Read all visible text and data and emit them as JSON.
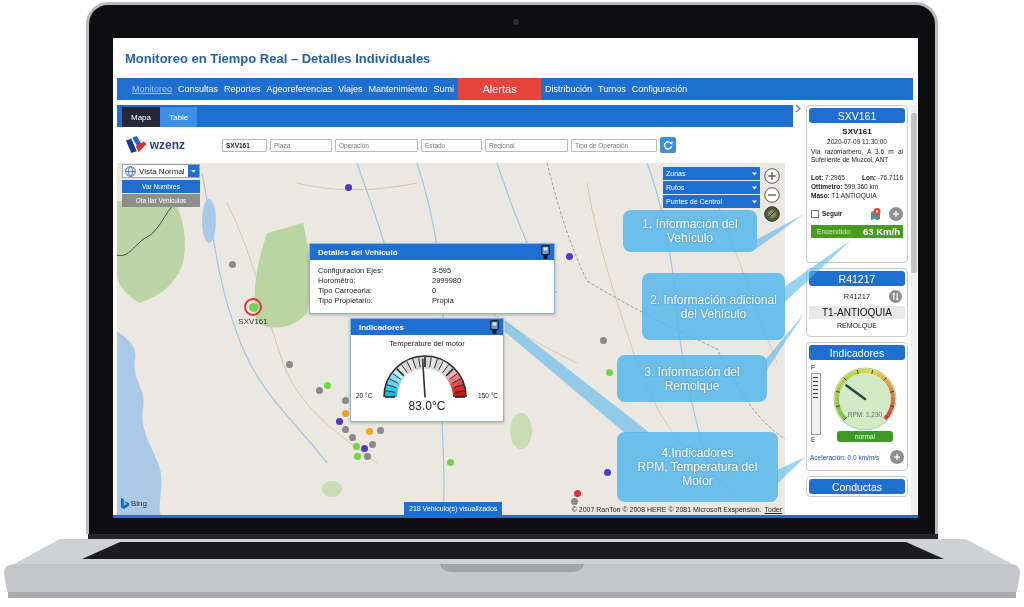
{
  "window": {
    "title": "Monitoreo en Tiempo Real – Detalles Individuales"
  },
  "nav": [
    {
      "label": "Monitoreo",
      "selected": true,
      "kind": "link"
    },
    {
      "label": "Consultas",
      "selected": false,
      "kind": "link"
    },
    {
      "label": "Reportes",
      "selected": false,
      "kind": "link"
    },
    {
      "label": "Ageoreferencias",
      "selected": false,
      "kind": "link"
    },
    {
      "label": "Viajes",
      "selected": false,
      "kind": "link"
    },
    {
      "label": "Mantenimiento",
      "selected": false,
      "kind": "link"
    },
    {
      "label": "Sumi",
      "selected": false,
      "kind": "link"
    },
    {
      "label": "Alertas",
      "selected": false,
      "kind": "alert"
    },
    {
      "label": "Distribución",
      "selected": false,
      "kind": "link"
    },
    {
      "label": "Turnos",
      "selected": false,
      "kind": "link"
    },
    {
      "label": "Configuración",
      "selected": false,
      "kind": "link"
    }
  ],
  "tabs": [
    {
      "label": "Mapa",
      "selected": true
    },
    {
      "label": "Table",
      "selected": false
    }
  ],
  "brand": {
    "name": "wzenz"
  },
  "filters": [
    {
      "value": "SXV161"
    },
    {
      "placeholder": "Plaza"
    },
    {
      "placeholder": "Operación"
    },
    {
      "placeholder": "Estado"
    },
    {
      "placeholder": "Regional"
    },
    {
      "placeholder": "Tipo de Operación"
    }
  ],
  "map": {
    "view_select": {
      "value": "Vista Normal"
    },
    "view_menu": [
      {
        "label": "Var Numbres",
        "selected": true
      },
      {
        "label": "Ota llar Vehiculos",
        "selected": false
      }
    ],
    "layers": [
      {
        "label": "Zunas"
      },
      {
        "label": "Rutos"
      },
      {
        "label": "Puntes de Centrol"
      }
    ],
    "markers": [
      {
        "color": "#4b3cc4",
        "selected": false
      },
      {
        "color": "#8a8a8a",
        "selected": false
      },
      {
        "color": "#72d44c",
        "selected": true,
        "label": "SXV161"
      },
      {
        "color": "#8a8a8a",
        "selected": false
      },
      {
        "color": "#8a8a8a",
        "selected": false
      },
      {
        "color": "#72d44c",
        "selected": false
      },
      {
        "color": "#8a8a8a",
        "selected": false
      },
      {
        "color": "#f0a526",
        "selected": false
      },
      {
        "color": "#4b3cc4",
        "selected": false
      },
      {
        "color": "#8a8a8a",
        "selected": false
      },
      {
        "color": "#8a8a8a",
        "selected": false
      },
      {
        "color": "#f0a526",
        "selected": false
      },
      {
        "color": "#8a8a8a",
        "selected": false
      },
      {
        "color": "#72d44c",
        "selected": false
      },
      {
        "color": "#4b3cc4",
        "selected": false
      },
      {
        "color": "#8a8a8a",
        "selected": false
      },
      {
        "color": "#8a8a8a",
        "selected": false
      },
      {
        "color": "#72d44c",
        "selected": false
      },
      {
        "color": "#72d44c",
        "selected": false
      },
      {
        "color": "#4b3cc4",
        "selected": false
      },
      {
        "color": "#8a8a8a",
        "selected": false
      },
      {
        "color": "#72d44c",
        "selected": false
      },
      {
        "color": "#4b3cc4",
        "selected": false
      },
      {
        "color": "#e0303a",
        "selected": false
      },
      {
        "color": "#8a8a8a",
        "selected": false
      }
    ],
    "details_popup": {
      "title": "Detalles del Vehiculo",
      "rows": [
        {
          "label": "Configuración Ejes:",
          "value": "3-595"
        },
        {
          "label": "Horomêtro:",
          "value": "2999980"
        },
        {
          "label": "Tipo Carroeoria:",
          "value": "0"
        },
        {
          "label": "Tipo Propietario:",
          "value": "Propia"
        }
      ]
    },
    "indicators_popup": {
      "title": "Indicadores",
      "gauge_title": "Temperature del motor",
      "min": "20 °C",
      "max": "150 °C",
      "reading": "83.0°C",
      "level": 0.48
    },
    "vehicle_count": "218 Vehiculo(s) visualizados",
    "provider": "Bing",
    "copyright": "© 2007 RanTon © 2008 HERE © 2081 Microsoft Exspension.",
    "terms_link": "Toder"
  },
  "sidebar": {
    "vehicle": {
      "title": "SXV161",
      "plate": "SXV161",
      "datetime": "2020-07-09 11:30:00",
      "address": "Via razomarbero, A 3.6 m al Suferiente de Muzcol, ANT",
      "lat": "**Lot:** 7:2965",
      "lon": "**Lon:** -76.7116",
      "odometer": "**Ottímetro:** 599.360 km",
      "mass": "**Maso:** T1:ANTIOQUIA",
      "follow": {
        "label": "Seguir",
        "checked": false
      },
      "status": "Encendido",
      "speed": "63 Km/h"
    },
    "trailer": {
      "title": "R41217",
      "code": "R41217",
      "region": "T1-ANTIOQUIA",
      "type": "REMOLQUE"
    },
    "indicators": {
      "title": "Indicadores",
      "fuel_full": "F",
      "fuel_empty": "E",
      "rpm": {
        "reading": "RPM: 1,230",
        "level": 0.3
      },
      "state": "normal",
      "acceleration": "Aceleración: 0,0 km/m/s"
    },
    "next_card": {
      "title": "Conductas"
    }
  },
  "callouts": [
    {
      "text": "1. Información del Vehículo"
    },
    {
      "text": "2. Información adicional del Vehículo"
    },
    {
      "text": "3. Información del Remolque"
    },
    {
      "text": "4.Indicadores\nRPM, Temperatura del Motor"
    }
  ]
}
